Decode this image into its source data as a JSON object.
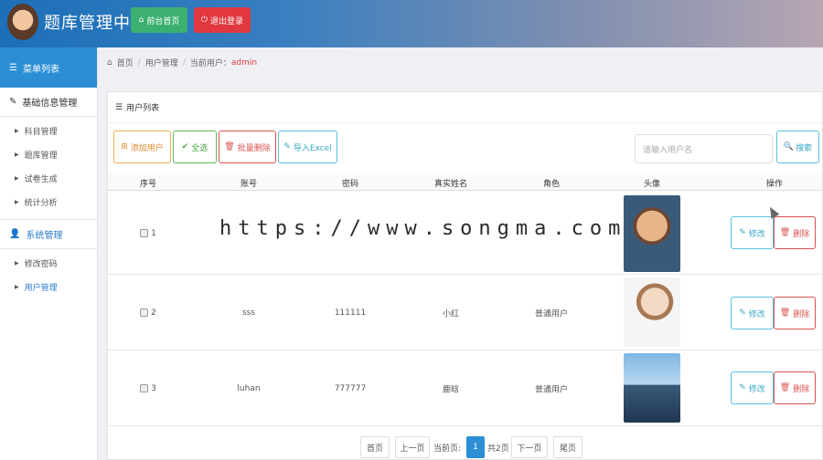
{
  "header": {
    "title": "题库管理中心",
    "home_button": "前台首页",
    "logout_button": "退出登录"
  },
  "sidebar": {
    "menu_title": "菜单列表",
    "groups": [
      {
        "title": "基础信息管理",
        "items": [
          "科目管理",
          "题库管理",
          "试卷生成",
          "统计分析"
        ]
      },
      {
        "title": "系统管理",
        "items": [
          "修改密码",
          "用户管理"
        ]
      }
    ],
    "active_item": "用户管理"
  },
  "breadcrumb": {
    "home": "首页",
    "section": "用户管理",
    "current_label": "当前用户：",
    "current_user": "admin"
  },
  "panel": {
    "title": "用户列表",
    "toolbar": {
      "add": "添加用户",
      "select_all": "全选",
      "batch_delete": "批量删除",
      "import": "导入Excel"
    },
    "search": {
      "placeholder": "请输入用户名",
      "button": "搜索"
    }
  },
  "table": {
    "columns": [
      "序号",
      "账号",
      "密码",
      "真实姓名",
      "角色",
      "头像",
      "操作"
    ],
    "rows": [
      {
        "index": "1",
        "account": "",
        "password": "",
        "real_name": "",
        "role": "",
        "avatar": "cartoon-boy-avatar"
      },
      {
        "index": "2",
        "account": "sss",
        "password": "111111",
        "real_name": "小红",
        "role": "普通用户",
        "avatar": "young-man-avatar"
      },
      {
        "index": "3",
        "account": "luhan",
        "password": "777777",
        "real_name": "鹿晗",
        "role": "普通用户",
        "avatar": "anime-avatar"
      }
    ],
    "edit_label": "修改",
    "delete_label": "删除"
  },
  "pagination": {
    "first": "首页",
    "prev": "上一页",
    "current_label": "当前页:",
    "current_page": "1",
    "total": "共2页",
    "next": "下一页",
    "last": "尾页"
  },
  "watermark": "https://www.songma.com",
  "colors": {
    "header_start": "#1c6fb8",
    "header_end": "#b7a6b2",
    "sidebar_head": "#2c8fd6",
    "success": "#3bb070",
    "danger": "#e0383e",
    "info": "#5bc0de",
    "warning": "#f0ad4e"
  }
}
